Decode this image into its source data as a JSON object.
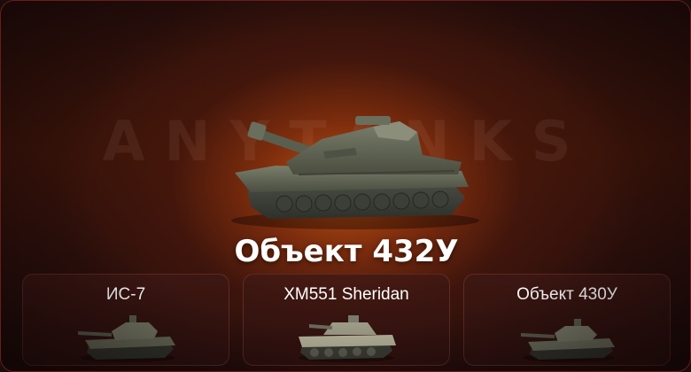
{
  "watermark": "ANYTANKS",
  "hero": {
    "title": "Объект 432У",
    "tank_icon": "tank-destroyer-icon"
  },
  "variants": [
    {
      "label": "ИС-7",
      "tank_icon": "heavy-tank-icon"
    },
    {
      "label": "XM551 Sheridan",
      "tank_icon": "light-tank-icon"
    },
    {
      "label": "Объект 430У",
      "tank_icon": "medium-tank-icon"
    }
  ],
  "colors": {
    "glow": "#c95814",
    "background": "#2a0f0c",
    "border": "#6a1c1c",
    "card_border": "#8c463c",
    "text": "#ffffff",
    "tank_body": "#5f6352"
  }
}
